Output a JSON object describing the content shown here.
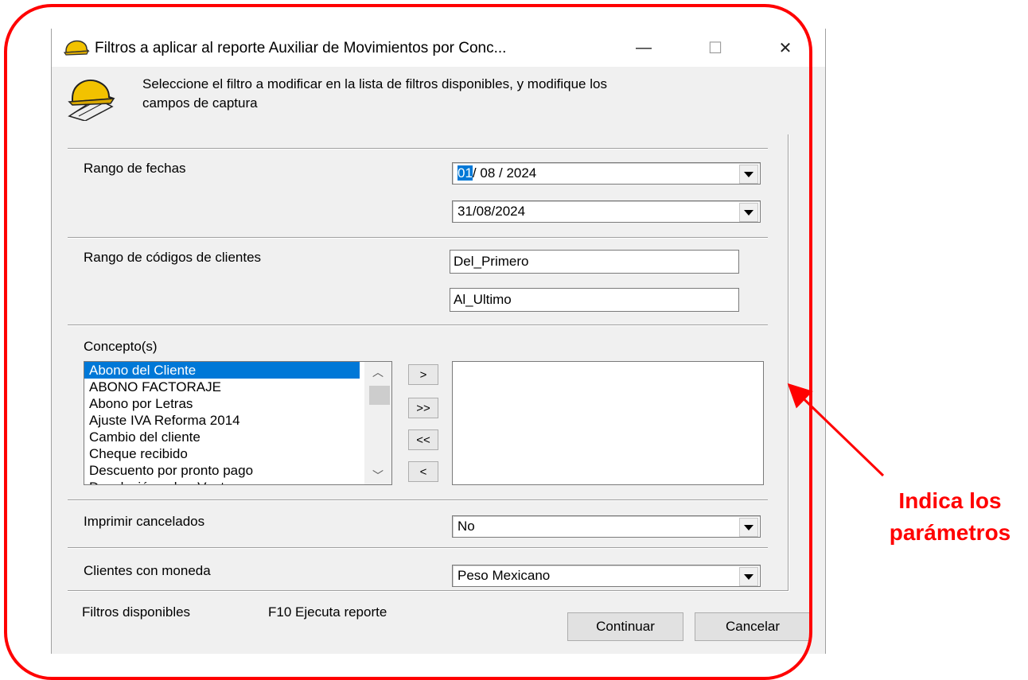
{
  "window": {
    "title": "Filtros a aplicar al reporte Auxiliar de Movimientos por Conc...",
    "minimize": "—",
    "maximize": "☐",
    "close": "✕"
  },
  "instructions": {
    "line1": "Seleccione el filtro a modificar  en la lista de filtros disponibles, y modifique los",
    "line2": "campos de  captura"
  },
  "date_range": {
    "label": "Rango de fechas",
    "from_day": "01",
    "from_rest": "/ 08 / 2024",
    "to": "31/08/2024"
  },
  "client_codes": {
    "label": "Rango de códigos de clientes",
    "from": "Del_Primero",
    "to": "Al_Ultimo"
  },
  "concepts": {
    "label": "Concepto(s)",
    "items": [
      "Abono del Cliente",
      "ABONO FACTORAJE",
      "Abono por Letras",
      "Ajuste IVA Reforma 2014",
      "Cambio del cliente",
      "Cheque recibido",
      "Descuento por pronto pago",
      "Devolución sobre Venta"
    ],
    "selected_index": 0,
    "buttons": {
      "add": ">",
      "add_all": ">>",
      "remove_all": "<<",
      "remove": "<"
    }
  },
  "print_cancelled": {
    "label": "Imprimir cancelados",
    "value": "No"
  },
  "currency": {
    "label": "Clientes con moneda",
    "value": "Peso Mexicano"
  },
  "status": {
    "filters": "Filtros disponibles",
    "hint": "F10 Ejecuta reporte"
  },
  "buttons": {
    "continue": "Continuar",
    "cancel": "Cancelar"
  },
  "annotation": {
    "line1": "Indica los",
    "line2": "parámetros",
    "color": "#ff0000"
  }
}
